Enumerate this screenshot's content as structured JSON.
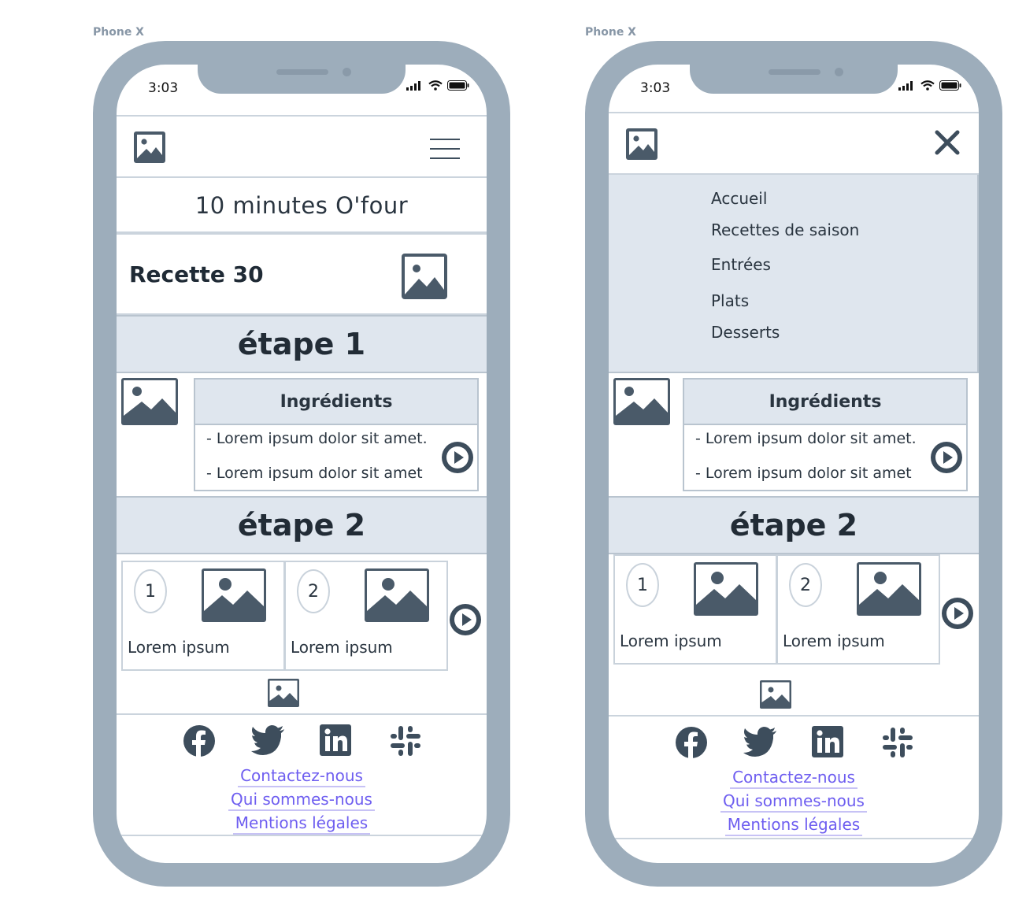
{
  "frames": [
    {
      "label": "Phone X",
      "status": {
        "time": "3:03"
      },
      "site_title": "10 minutes O'four",
      "recipe_title": "Recette 30",
      "step1": {
        "heading": "étape 1",
        "ingredients_heading": "Ingrédients",
        "lines": [
          "- Lorem ipsum dolor sit amet.",
          "- Lorem ipsum dolor sit amet"
        ]
      },
      "step2": {
        "heading": "étape 2",
        "cards": [
          {
            "number": "1",
            "text": "Lorem ipsum"
          },
          {
            "number": "2",
            "text": "Lorem ipsum"
          }
        ]
      },
      "footer": {
        "links": [
          "Contactez-nous",
          "Qui sommes-nous",
          "Mentions légales"
        ]
      }
    },
    {
      "label": "Phone X",
      "status": {
        "time": "3:03"
      },
      "menu": [
        "Accueil",
        "Recettes de saison",
        "Entrées",
        "Plats",
        "Desserts"
      ],
      "step1": {
        "ingredients_heading": "Ingrédients",
        "lines": [
          "- Lorem ipsum dolor sit amet.",
          "- Lorem ipsum dolor sit amet"
        ]
      },
      "step2": {
        "heading": "étape 2",
        "cards": [
          {
            "number": "1",
            "text": "Lorem ipsum"
          },
          {
            "number": "2",
            "text": "Lorem ipsum"
          }
        ]
      },
      "footer": {
        "links": [
          "Contactez-nous",
          "Qui sommes-nous",
          "Mentions légales"
        ]
      }
    }
  ],
  "icons": [
    "image-icon",
    "menu-icon",
    "close-icon",
    "play-icon",
    "facebook-icon",
    "twitter-icon",
    "linkedin-icon",
    "slack-icon",
    "signal-icon",
    "wifi-icon",
    "battery-icon"
  ],
  "colors": {
    "frame": "#9dadbb",
    "panel": "#dfe6ee",
    "link": "#6e5ef0",
    "icon": "#4a5a69"
  }
}
